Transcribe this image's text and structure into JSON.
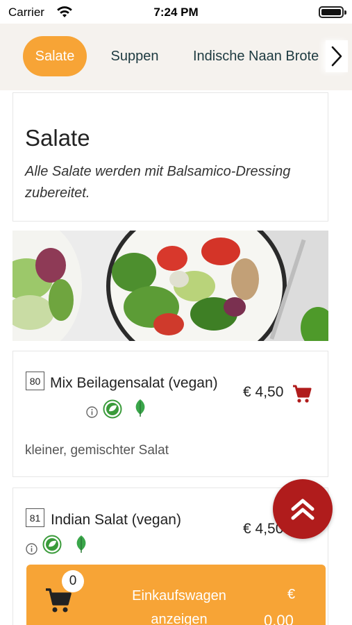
{
  "status_bar": {
    "carrier": "Carrier",
    "time": "7:24 PM"
  },
  "categories": [
    {
      "label": "Salate",
      "active": true
    },
    {
      "label": "Suppen",
      "active": false
    },
    {
      "label": "Indische Naan Brote",
      "active": false
    }
  ],
  "section": {
    "title": "Salate",
    "description": "Alle Salate werden mit Balsamico-Dressing zubereitet."
  },
  "products": [
    {
      "number": "80",
      "name": "Mix Beilagensalat (vegan)",
      "price": "€ 4,50",
      "description": "kleiner, gemischter Salat"
    },
    {
      "number": "81",
      "name": "Indian Salat (vegan)",
      "price": "€ 4,50"
    }
  ],
  "cart": {
    "count": "0",
    "label": "Einkaufswagen anzeigen",
    "currency": "€",
    "total": "0,00"
  },
  "colors": {
    "accent": "#f7a436",
    "fab": "#b01c1c",
    "cart_icon": "#b01c1c",
    "vegan_green": "#3a9b3a"
  },
  "icons": [
    "wifi-icon",
    "battery-icon",
    "chevron-right-icon",
    "info-icon",
    "vegan-icon",
    "leaf-icon",
    "add-to-cart-icon",
    "scroll-top-icon",
    "cart-icon"
  ]
}
